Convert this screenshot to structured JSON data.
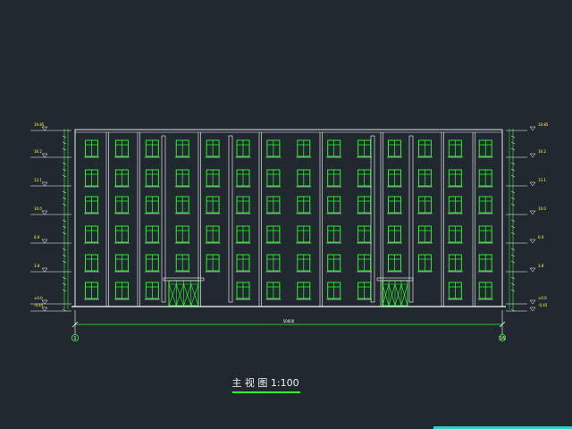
{
  "drawing": {
    "title": "主 视 图 1:100",
    "overall_width_dimension": "50600",
    "axis_left": "1",
    "axis_right": "16",
    "colors": {
      "background": "#212830",
      "outline": "#ffffff",
      "window": "#33ff33",
      "dimension_line": "#33ff33",
      "level_mark": "#ffff40",
      "title_underline": "#33ff33",
      "accent_bar": "#33cccc"
    },
    "facade": {
      "floors": 6,
      "window_columns": 14,
      "entrance_count": 2
    },
    "left_levels": [
      {
        "label": "19.85"
      },
      {
        "label": "16.2"
      },
      {
        "label": "13.1"
      },
      {
        "label": "10.0"
      },
      {
        "label": "6.9"
      },
      {
        "label": "3.8"
      },
      {
        "label": "±0.0"
      },
      {
        "label": "-0.45"
      }
    ],
    "right_levels": [
      {
        "label": "19.85"
      },
      {
        "label": "16.2"
      },
      {
        "label": "13.1"
      },
      {
        "label": "10.0"
      },
      {
        "label": "6.9"
      },
      {
        "label": "3.8"
      },
      {
        "label": "±0.0"
      },
      {
        "label": "-0.45"
      }
    ]
  }
}
